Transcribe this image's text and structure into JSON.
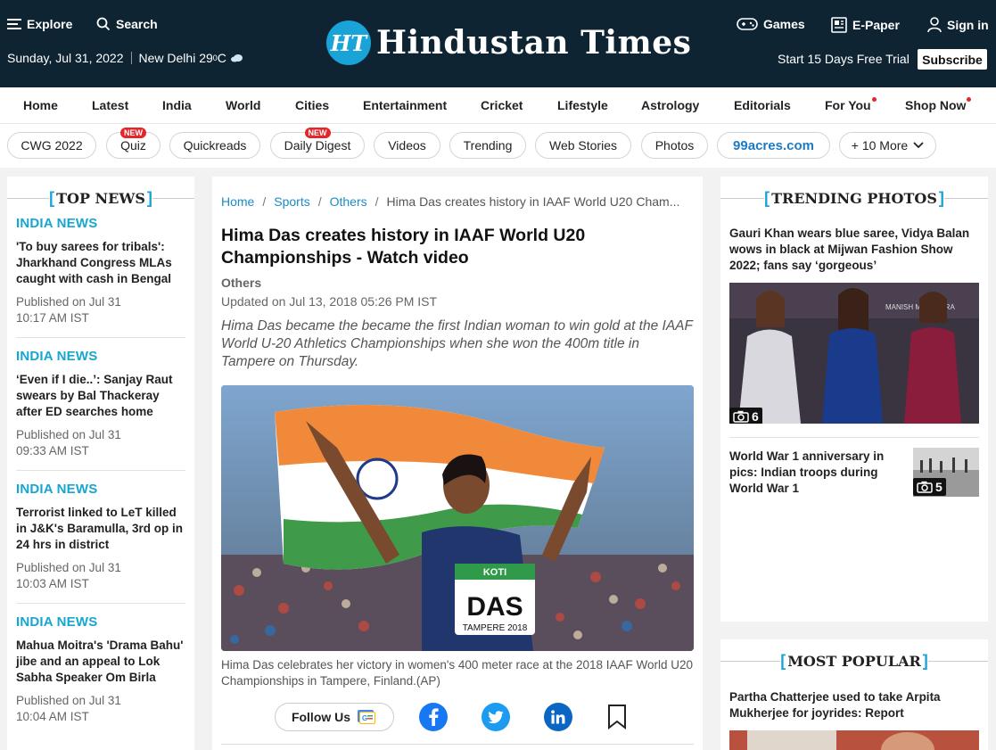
{
  "header": {
    "explore": "Explore",
    "search": "Search",
    "games": "Games",
    "epaper": "E-Paper",
    "signin": "Sign in",
    "date": "Sunday, Jul 31, 2022",
    "city": "New Delhi 29",
    "temp_unit_sup": "0",
    "temp_unit": "C",
    "logo_badge": "HT",
    "logo_text": "Hindustan Times",
    "trial": "Start 15 Days Free Trial",
    "subscribe": "Subscribe"
  },
  "nav": {
    "items": [
      "Home",
      "Latest",
      "India",
      "World",
      "Cities",
      "Entertainment",
      "Cricket",
      "Lifestyle",
      "Astrology",
      "Editorials",
      "For You",
      "Shop Now"
    ]
  },
  "chips": {
    "items": [
      "CWG 2022",
      "Quiz",
      "Quickreads",
      "Daily Digest",
      "Videos",
      "Trending",
      "Web Stories",
      "Photos",
      "99acres.com",
      "+ 10 More"
    ],
    "new_badge": "NEW"
  },
  "top_news": {
    "heading": "TOP NEWS",
    "items": [
      {
        "category": "INDIA NEWS",
        "title": "'To buy sarees for tribals': Jharkhand Congress MLAs caught with cash in Bengal",
        "published": "Published on Jul 31",
        "time": "10:17 AM IST"
      },
      {
        "category": "INDIA NEWS",
        "title": "‘Even if I die..’: Sanjay Raut swears by Bal Thackeray after ED searches home",
        "published": "Published on Jul 31",
        "time": "09:33 AM IST"
      },
      {
        "category": "INDIA NEWS",
        "title": "Terrorist linked to LeT killed in J&K's Baramulla, 3rd op in 24 hrs in district",
        "published": "Published on Jul 31",
        "time": "10:03 AM IST"
      },
      {
        "category": "INDIA NEWS",
        "title": "Mahua Moitra's 'Drama Bahu' jibe and an appeal to Lok Sabha Speaker Om Birla",
        "published": "Published on Jul 31",
        "time": "10:04 AM IST"
      }
    ]
  },
  "article": {
    "breadcrumb": [
      "Home",
      "Sports",
      "Others",
      "Hima Das creates history in IAAF World U20 Cham..."
    ],
    "title": "Hima Das creates history in IAAF World U20 Championships - Watch video",
    "section": "Others",
    "updated": "Updated on Jul 13, 2018 05:26 PM IST",
    "summary": "Hima Das became the became the first Indian woman to win gold at the IAAF World U-20 Athletics Championships when she won the 400m title in Tampere on Thursday.",
    "bib_name": "DAS",
    "bib_sponsor": "KOTI",
    "bib_event": "TAMPERE 2018",
    "caption": "Hima Das celebrates her victory in women's 400 meter race at the 2018 IAAF World U20 Championships in Tampere, Finland.(AP)",
    "follow_us": "Follow Us"
  },
  "trending_photos": {
    "heading": "TRENDING PHOTOS",
    "items": [
      {
        "title": "Gauri Khan wears blue saree, Vidya Balan wows in black at Mijwan Fashion Show 2022; fans say ‘gorgeous’",
        "count": "6",
        "backdrop_text": "MANISH MALHOTRA"
      },
      {
        "title": "World War 1 anniversary in pics: Indian troops during World War 1",
        "count": "5"
      }
    ]
  },
  "most_popular": {
    "heading": "MOST POPULAR",
    "items": [
      {
        "title": "Partha Chatterjee used to take Arpita Mukherjee for joyrides: Report"
      }
    ]
  }
}
